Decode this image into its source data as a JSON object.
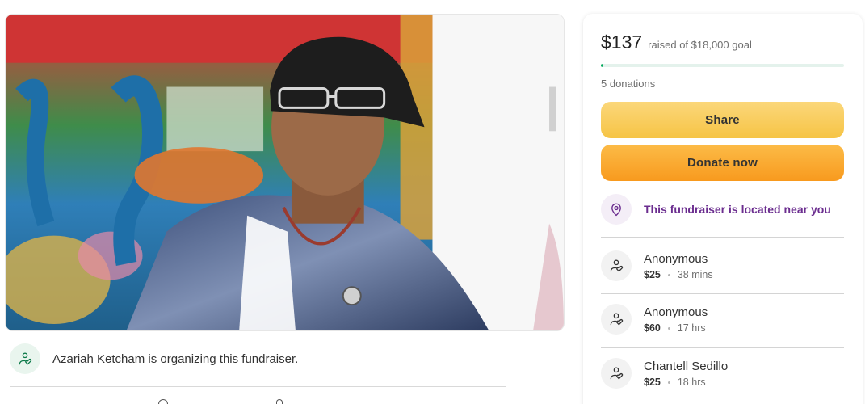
{
  "organizer": {
    "text": "Azariah Ketcham is organizing this fundraiser.",
    "icon": "heart-hand-icon"
  },
  "campaign": {
    "raised": "$137",
    "goal_text": "raised of $18,000 goal",
    "progress_fraction": 0.0076,
    "donation_count": "5 donations"
  },
  "buttons": {
    "share_label": "Share",
    "donate_label": "Donate now"
  },
  "location": {
    "text": "This fundraiser is located near you",
    "icon": "map-pin-icon"
  },
  "donations": [
    {
      "name": "Anonymous",
      "amount": "$25",
      "time": "38 mins"
    },
    {
      "name": "Anonymous",
      "amount": "$60",
      "time": "17 hrs"
    },
    {
      "name": "Chantell Sedillo",
      "amount": "$25",
      "time": "18 hrs"
    }
  ],
  "colors": {
    "progress": "#02a95c",
    "share_button": "#f6c445",
    "donate_button": "#f89a1e",
    "location_text": "#6b2d8f"
  }
}
